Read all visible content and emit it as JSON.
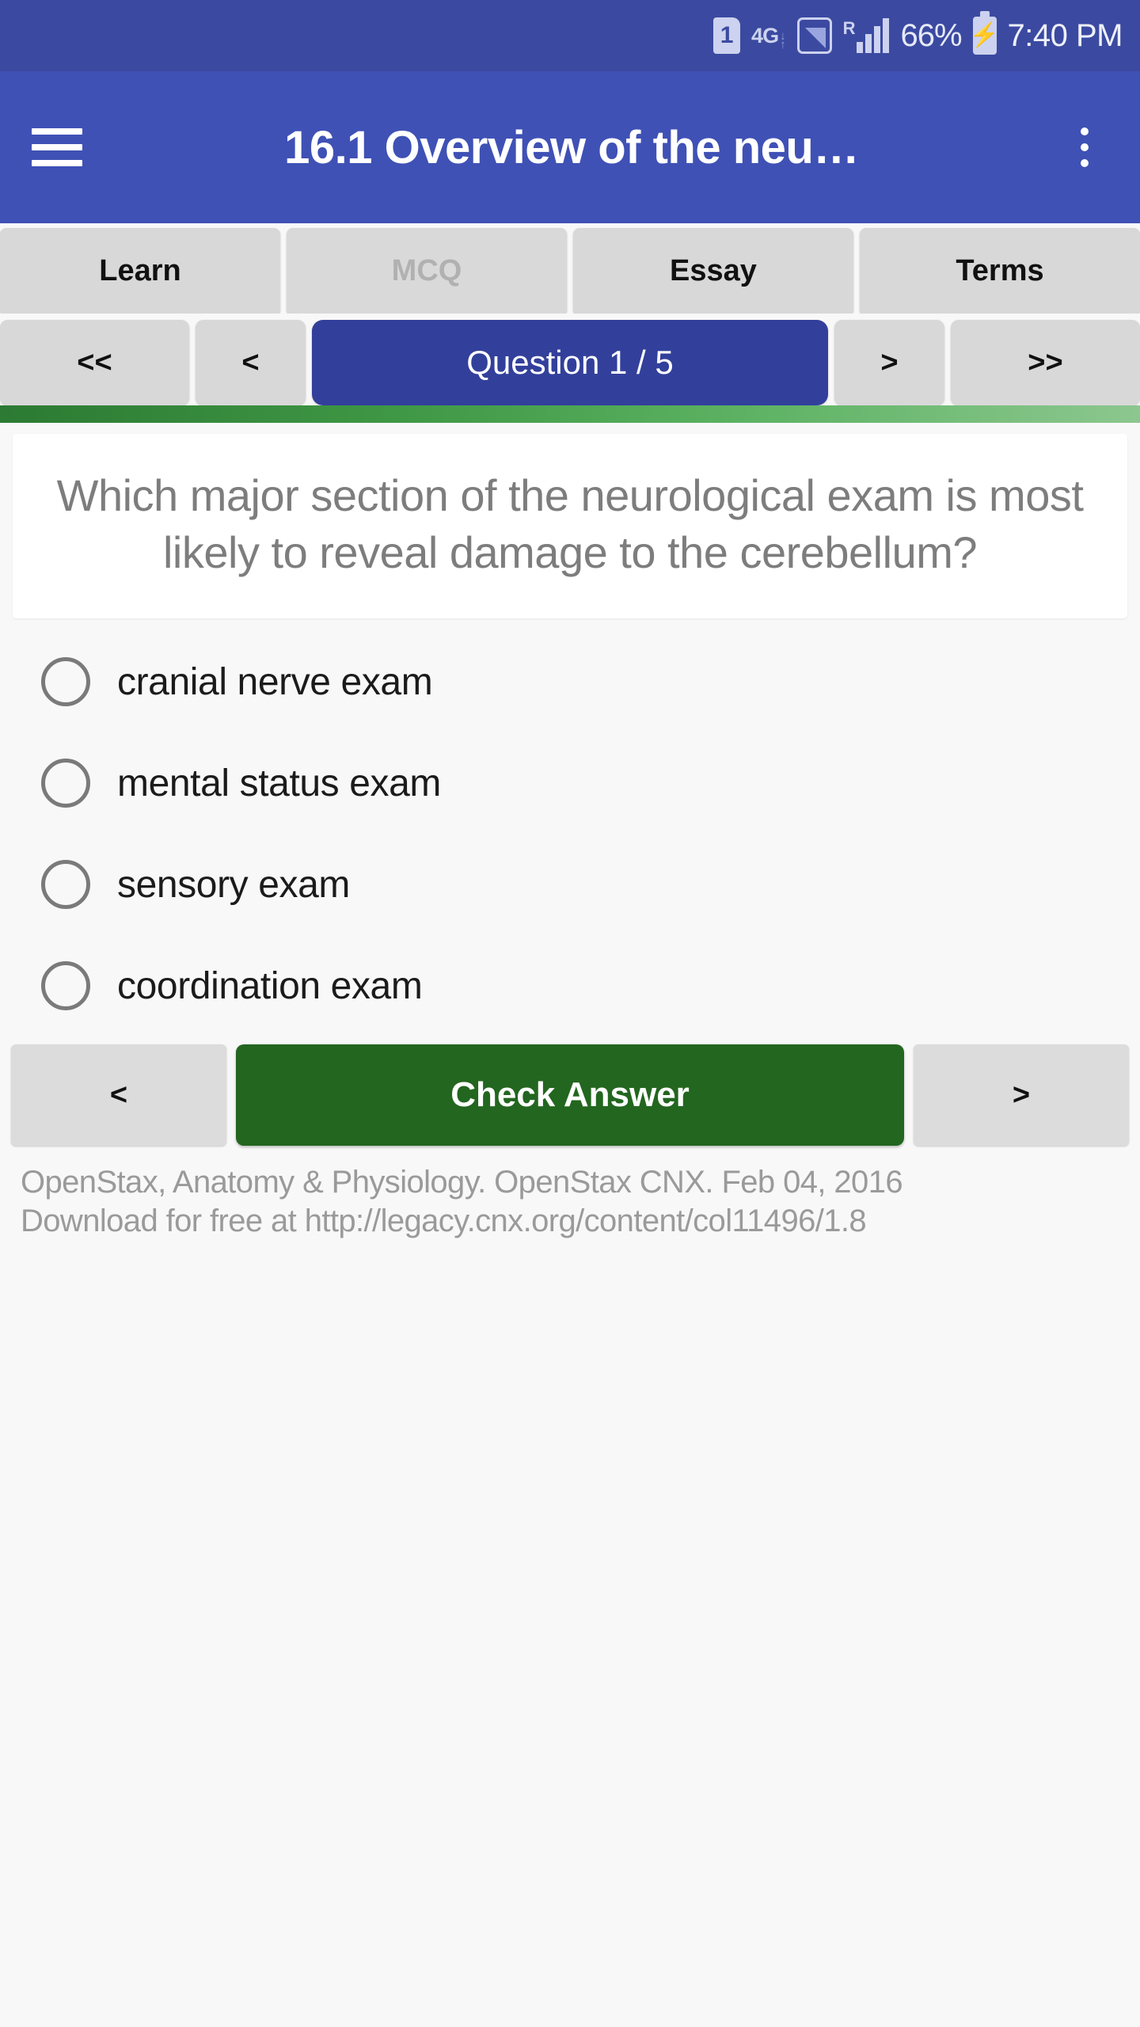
{
  "statusbar": {
    "sim_label": "1",
    "network_type": "4G",
    "roaming_label": "R",
    "battery_percent": "66%",
    "time": "7:40 PM",
    "icons": [
      "sim-card-icon",
      "4g-data-icon",
      "wifi-signal-icon",
      "roaming-signal-icon",
      "battery-charging-icon"
    ]
  },
  "appbar": {
    "menu_icon": "hamburger-menu-icon",
    "title": "16.1 Overview of the neu…",
    "overflow_icon": "overflow-menu-icon",
    "color": "#3f51b5"
  },
  "tabs": [
    {
      "label": "Learn",
      "active": false
    },
    {
      "label": "MCQ",
      "active": true
    },
    {
      "label": "Essay",
      "active": false
    },
    {
      "label": "Terms",
      "active": false
    }
  ],
  "question_nav": {
    "first_label": "<<",
    "prev_label": "<",
    "counter_label": "Question 1 / 5",
    "next_label": ">",
    "last_label": ">>",
    "counter_color": "#32409b",
    "current": 1,
    "total": 5
  },
  "progress": {
    "gradient_start": "#2c7a33",
    "gradient_end": "#8cc78f"
  },
  "question": {
    "text": "Which major section of the neurological exam is most likely to reveal damage to the cerebellum?"
  },
  "options": [
    {
      "label": "cranial nerve exam",
      "selected": false
    },
    {
      "label": "mental status exam",
      "selected": false
    },
    {
      "label": "sensory exam",
      "selected": false
    },
    {
      "label": "coordination exam",
      "selected": false
    }
  ],
  "actions": {
    "prev_label": "<",
    "check_label": "Check Answer",
    "next_label": ">",
    "check_color": "#23661f"
  },
  "attribution": {
    "line1": "OpenStax, Anatomy & Physiology. OpenStax CNX. Feb 04, 2016",
    "line2": "Download for free at http://legacy.cnx.org/content/col11496/1.8"
  }
}
